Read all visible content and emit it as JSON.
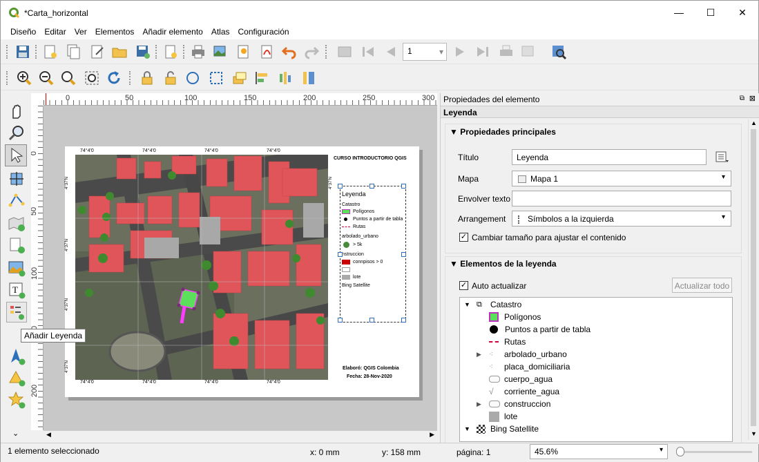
{
  "window": {
    "title": "*Carta_horizontal",
    "minimize": "—",
    "maximize": "☐",
    "close": "✕"
  },
  "menu": [
    "Diseño",
    "Editar",
    "Ver",
    "Elementos",
    "Añadir elemento",
    "Atlas",
    "Configuración"
  ],
  "toolbar": {
    "page_value": "1"
  },
  "ruler": {
    "top_ticks": [
      "0",
      "50",
      "100",
      "150",
      "200",
      "250",
      "300"
    ],
    "left_ticks": [
      "0",
      "50",
      "100",
      "150",
      "200"
    ]
  },
  "page": {
    "title": "CURSO INTRODUCTORIO QGIS",
    "credit": "Elaboró: QGIS Colombia",
    "date": "Fecha: 28-Nov-2020",
    "grid_top": [
      "74°4'0",
      "74°4'0",
      "74°4'0",
      "74°4'0"
    ],
    "grid_bottom": [
      "74°4'0",
      "74°4'0",
      "74°4'0",
      "74°4'0"
    ],
    "grid_left": [
      "4°37'N",
      "4°37'N",
      "4°37'N",
      "4°37'N"
    ],
    "grid_right": [
      "4°37'N"
    ],
    "legend": {
      "title": "Leyenda",
      "group": "Catastro",
      "items": [
        "Polígonos",
        "Puntos a partir de tabla",
        "Rutas",
        "arbolado_urbano",
        "> 5k",
        "nstruccion",
        "connpisos > 0",
        "lote",
        "Bing Satellite"
      ]
    }
  },
  "panel": {
    "header": "Propiedades del elemento",
    "subheader": "Leyenda",
    "main_section": "Propiedades principales",
    "titulo_label": "Título",
    "titulo_value": "Leyenda",
    "mapa_label": "Mapa",
    "mapa_value": "Mapa 1",
    "wrap_label": "Envolver texto",
    "wrap_value": "",
    "arr_label": "Arrangement",
    "arr_value": "Símbolos a la izquierda",
    "resize_label": "Cambiar tamaño para ajustar el contenido",
    "items_section": "Elementos de la leyenda",
    "auto_label": "Auto actualizar",
    "update_all": "Actualizar todo",
    "tree": [
      "Catastro",
      "Polígonos",
      "Puntos a partir de tabla",
      "Rutas",
      "arbolado_urbano",
      "placa_domiciliaria",
      "cuerpo_agua",
      "corriente_agua",
      "construccion",
      "lote",
      "Bing Satellite"
    ]
  },
  "status": {
    "selection": "1 elemento seleccionado",
    "x": "x: 0 mm",
    "y": "y: 158 mm",
    "page": "página: 1",
    "zoom": "45.6%"
  },
  "tooltip": "Añadir Leyenda",
  "colors": {
    "accent": "#589632",
    "polygon_fill": "#5ce05c",
    "building": "#e0555a",
    "selection": "#ff3cff"
  }
}
